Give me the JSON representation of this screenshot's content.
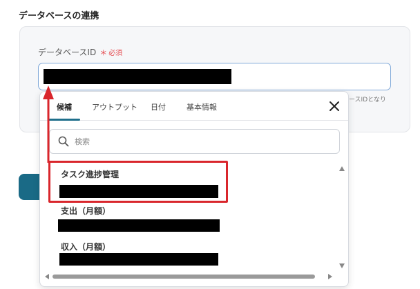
{
  "section": {
    "title": "データベースの連携"
  },
  "field": {
    "label": "データベースID",
    "required_mark": "＊",
    "required_text": "必須",
    "hint": "ースIDとなり"
  },
  "dropdown": {
    "tabs": [
      {
        "label": "候補",
        "active": true
      },
      {
        "label": "アウトプット",
        "active": false
      },
      {
        "label": "日付",
        "active": false
      },
      {
        "label": "基本情報",
        "active": false
      }
    ],
    "search": {
      "placeholder": "検索",
      "value": ""
    },
    "items": [
      {
        "label": "タスク進捗管理",
        "highlighted": true
      },
      {
        "label": "支出（月額）",
        "highlighted": false
      },
      {
        "label": "収入（月額）",
        "highlighted": false
      }
    ],
    "icons": {
      "close": "close-icon",
      "search": "search-icon"
    }
  },
  "colors": {
    "accent": "#1f6f8b",
    "required": "#e5484d",
    "annotation": "#d9262c",
    "input_border": "#7fa8d8"
  }
}
